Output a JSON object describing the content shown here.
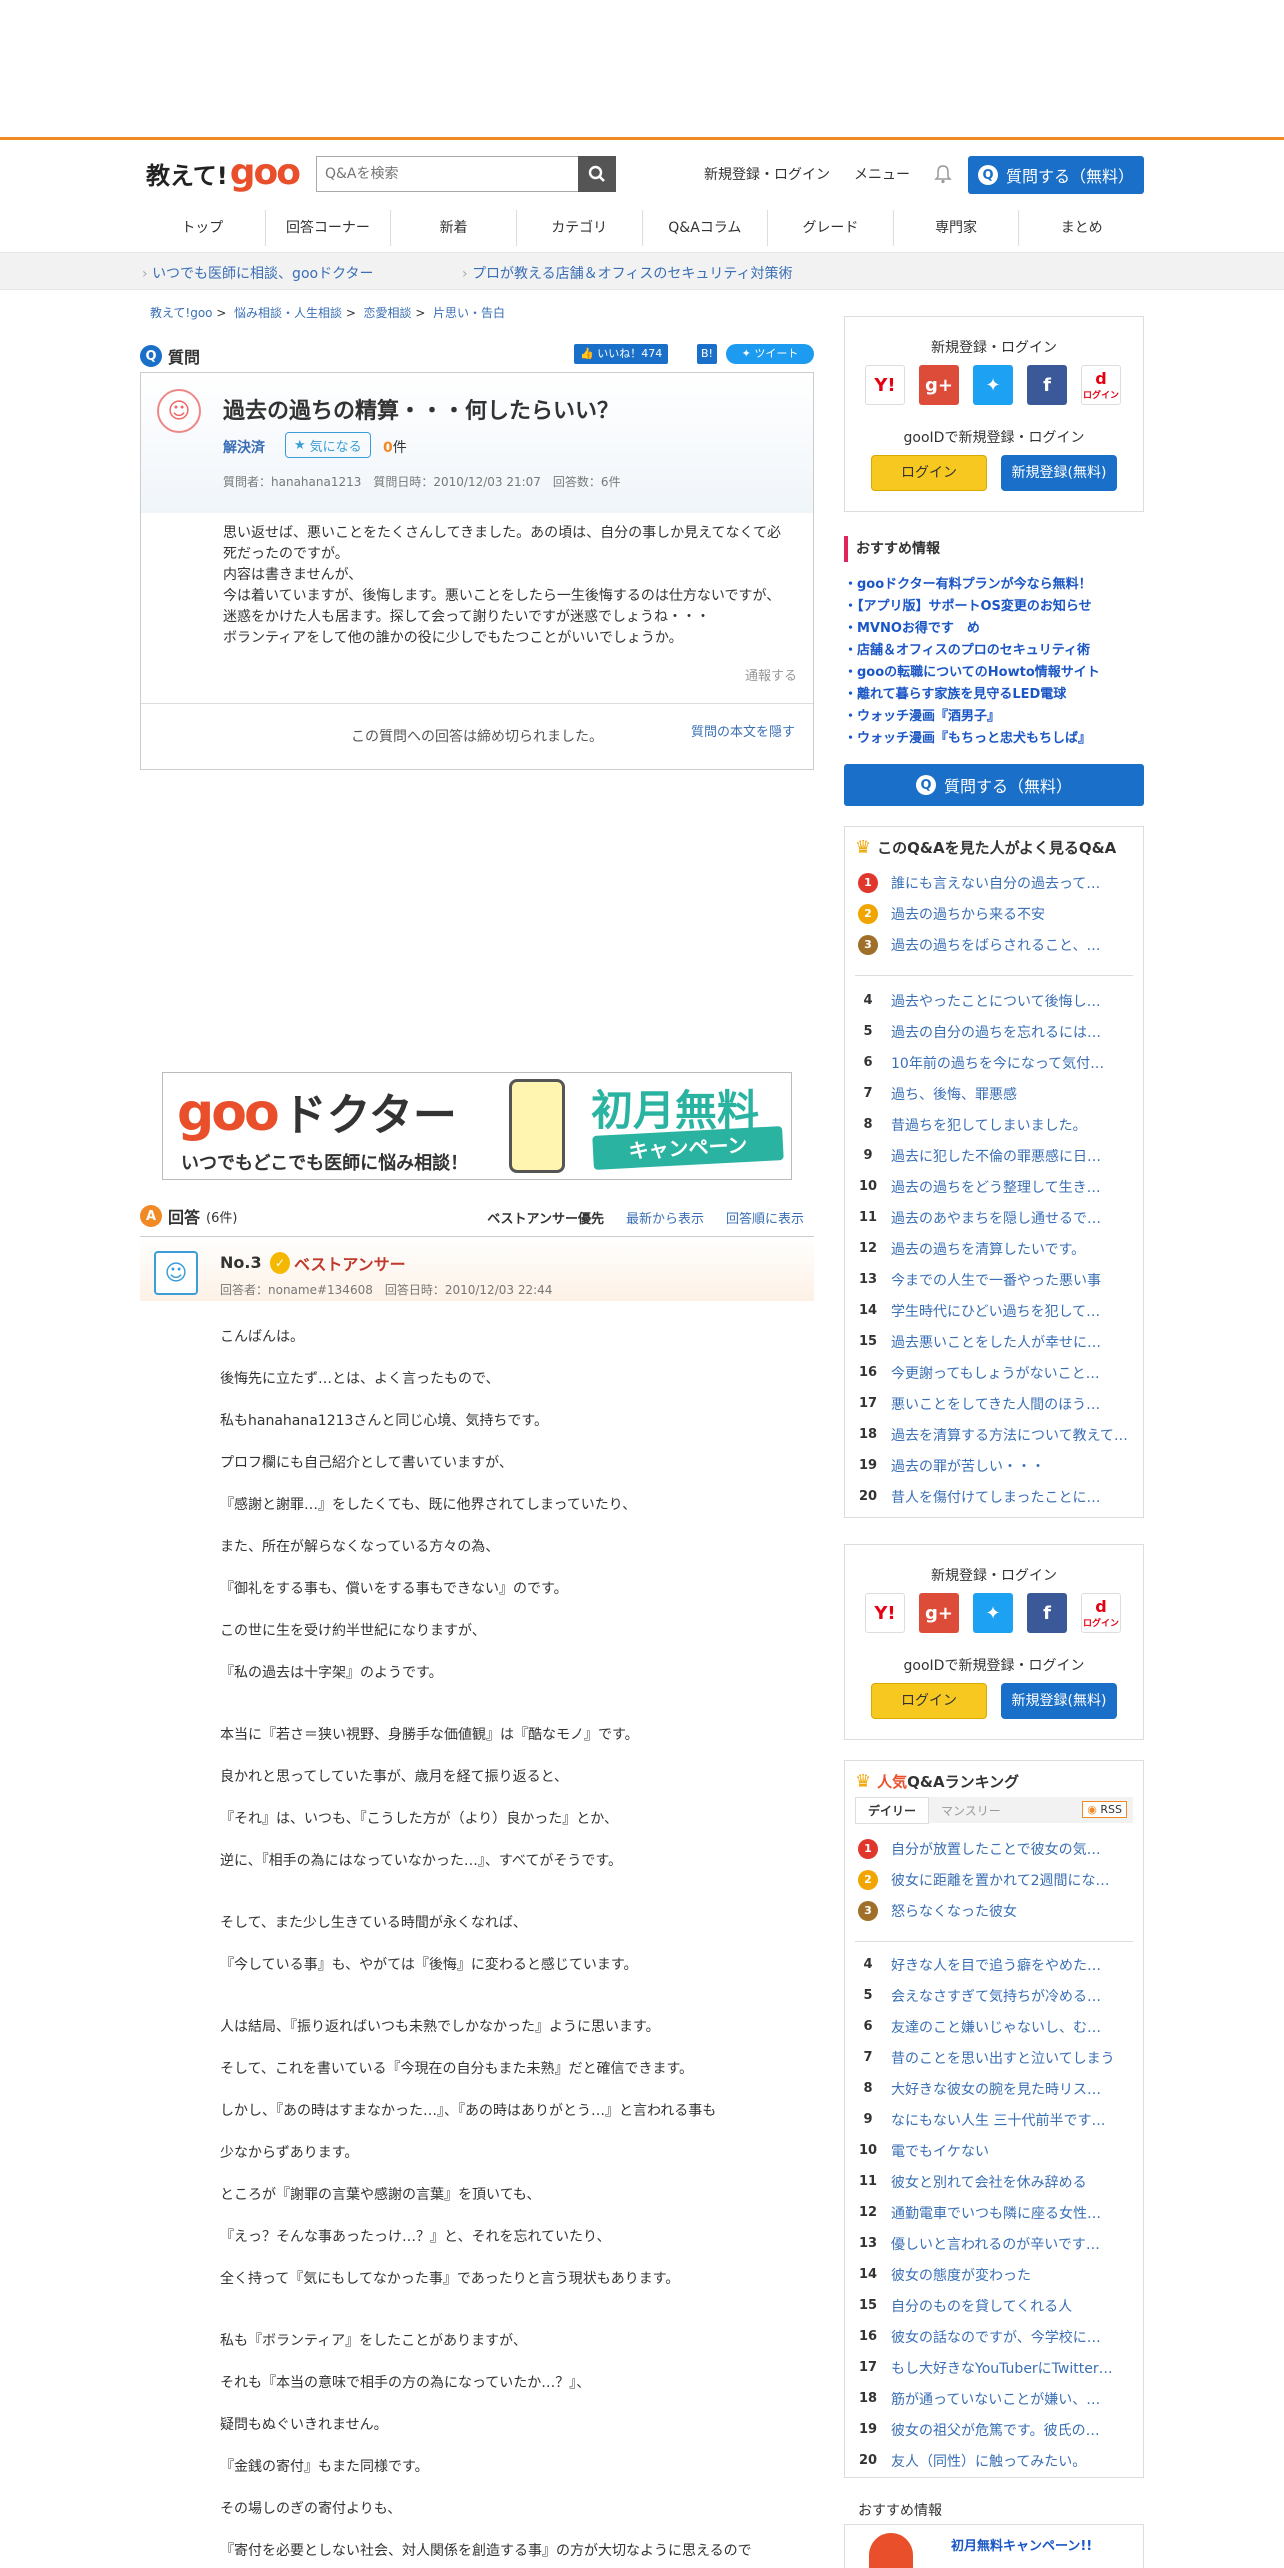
{
  "header": {
    "logo_text": "教えて!",
    "logo_brand": "goo",
    "search_placeholder": "Q&Aを検索",
    "links": [
      "新規登録・ログイン",
      "メニュー"
    ],
    "ask_button": "質問する（無料）"
  },
  "nav": [
    "トップ",
    "回答コーナー",
    "新着",
    "カテゴリ",
    "Q&Aコラム",
    "グレード",
    "専門家",
    "まとめ"
  ],
  "subbar": [
    "いつでも医師に相談、gooドクター",
    "プロが教える店舗＆オフィスのセキュリティ対策術"
  ],
  "breadcrumb": [
    "教えて!goo",
    "悩み相談・人生相談",
    "恋愛相談",
    "片思い・告白"
  ],
  "question": {
    "section_label": "質問",
    "like_label": "いいね！474",
    "tweet_label": "ツイート",
    "title": "過去の過ちの精算・・・何したらいい？",
    "status": "解決済",
    "fav_label": "気になる",
    "fav_count": "0",
    "fav_unit": "件",
    "meta": "質問者：hanahana1213　質問日時：2010/12/03 21:07　回答数：6件",
    "body": "思い返せば、悪いことをたくさんしてきました。あの頃は、自分の事しか見えてなくて必死だったのですが。\n内容は書きませんが、\n今は着いていますが、後悔します。悪いことをしたら一生後悔するのは仕方ないですが、迷惑をかけた人も居ます。探して会って謝りたいですが迷惑でしょうね・・・\nボランティアをして他の誰かの役に少しでもたつことがいいでしょうか。",
    "report": "通報する",
    "closed": "この質問への回答は締め切られました。",
    "hide": "質問の本文を隠す"
  },
  "banner": {
    "brand": "goo",
    "title": "ドクター",
    "sub": "いつでもどこでも医師に悩み相談！",
    "campaign": "初月無料",
    "campaign2": "キャンペーン"
  },
  "answers": {
    "section_label": "回答",
    "count": "(6件)",
    "sort": [
      "ベストアンサー優先",
      "最新から表示",
      "回答順に表示"
    ],
    "no": "No.3",
    "best": "ベストアンサー",
    "meta": "回答者：noname#134608　回答日時：2010/12/03 22:44",
    "paragraphs": [
      "こんばんは。",
      "後悔先に立たず…とは、よく言ったもので、",
      "私もhanahana1213さんと同じ心境、気持ちです。",
      "プロフ欄にも自己紹介として書いていますが、",
      "『感謝と謝罪…』をしたくても、既に他界されてしまっていたり、",
      "また、所在が解らなくなっている方々の為、",
      "『御礼をする事も、償いをする事もできない』のです。",
      "この世に生を受け約半世紀になりますが、",
      "『私の過去は十字架』のようです。",
      "",
      "本当に『若さ＝狭い視野、身勝手な価値観』は『酷なモノ』です。",
      "良かれと思ってしていた事が、歳月を経て振り返ると、",
      "『それ』は、いつも、『こうした方が（より）良かった』とか、",
      "逆に、『相手の為にはなっていなかった…』、すべてがそうです。",
      "",
      "そして、また少し生きている時間が永くなれば、",
      "『今している事』も、やがては『後悔』に変わると感じています。",
      "",
      "人は結局、『振り返ればいつも未熟でしかなかった』ように思います。",
      "そして、これを書いている『今現在の自分もまた未熟』だと確信できます。",
      "しかし、『あの時はすまなかった…』、『あの時はありがとう…』と言われる事も",
      "少なからずあります。",
      "ところが『謝罪の言葉や感謝の言葉』を頂いても、",
      "『えっ？そんな事あったっけ…？』と、それを忘れていたり、",
      "全く持って『気にもしてなかった事』であったりと言う現状もあります。",
      "",
      "私も『ボランティア』をしたことがありますが、",
      "それも『本当の意味で相手の方の為になっていたか…？』、",
      "疑問もぬぐいきれません。",
      "『金銭の寄付』もまた同様です。",
      "その場しのぎの寄付よりも、",
      "『寄付を必要としない社会、対人関係を創造する事』の方が大切なように思えるので"
    ]
  },
  "sidebar": {
    "login": {
      "title": "新規登録・ログイン",
      "sub": "gooIDで新規登録・ログイン",
      "login_btn": "ログイン",
      "register_btn": "新規登録(無料)",
      "d_label": "ログイン"
    },
    "recommend_title": "おすすめ情報",
    "recommend": [
      "・gooドクター有料プランが今なら無料！",
      "・【アプリ版】サポートOS変更のお知らせ",
      "・MVNOお得です　め",
      "・店舗＆オフィスのプロのセキュリティ術",
      "・gooの転職についてのHowto情報サイト",
      "・離れて暮らす家族を見守るLED電球",
      "・ウォッチ漫画『酒男子』",
      "・ウォッチ漫画『もちっと忠犬もちしば』"
    ],
    "ask_button": "質問する（無料）",
    "related_title": "このQ&Aを見た人がよく見るQ&A",
    "related": [
      "誰にも言えない自分の過去って…",
      "過去の過ちから来る不安",
      "過去の過ちをばらされること、…",
      "過去やったことについて後悔し…",
      "過去の自分の過ちを忘れるには…",
      "10年前の過ちを今になって気付…",
      "過ち、後悔、罪悪感",
      "昔過ちを犯してしまいました。",
      "過去に犯した不倫の罪悪感に日…",
      "過去の過ちをどう整理して生き…",
      "過去のあやまちを隠し通せるで…",
      "過去の過ちを清算したいです。",
      "今までの人生で一番やった悪い事",
      "学生時代にひどい過ちを犯して…",
      "過去悪いことをした人が幸せに…",
      "今更謝ってもしょうがないこと…",
      "悪いことをしてきた人間のほう…",
      "過去を清算する方法について教えて…",
      "過去の罪が苦しい・・・",
      "昔人を傷付けてしまったことに…"
    ],
    "ranking_title_a": "人気",
    "ranking_title_b": "Q&Aランキング",
    "ranking_tabs": [
      "デイリー",
      "マンスリー"
    ],
    "rss": "RSS",
    "ranking": [
      "自分が放置したことで彼女の気…",
      "彼女に距離を置かれて2週間にな…",
      "怒らなくなった彼女",
      "好きな人を目で追う癖をやめた…",
      "会えなさすぎて気持ちが冷める…",
      "友達のこと嫌いじゃないし、む…",
      "昔のことを思い出すと泣いてしまう",
      "大好きな彼女の腕を見た時リス…",
      "なにもない人生 三十代前半です…",
      "電でもイケない",
      "彼女と別れて会社を休み辞める",
      "通勤電車でいつも隣に座る女性…",
      "優しいと言われるのが辛いです…",
      "彼女の態度が変わった",
      "自分のものを貸してくれる人",
      "彼女の話なのですが、今学校に…",
      "もし大好きなYouTuberにTwitter…",
      "筋が通っていないことが嫌い、…",
      "彼女の祖父が危篤です。彼氏の…",
      "友人（同性）に触ってみたい。"
    ],
    "footer_title": "おすすめ情報",
    "footer_item": "初月無料キャンペーン!!"
  }
}
